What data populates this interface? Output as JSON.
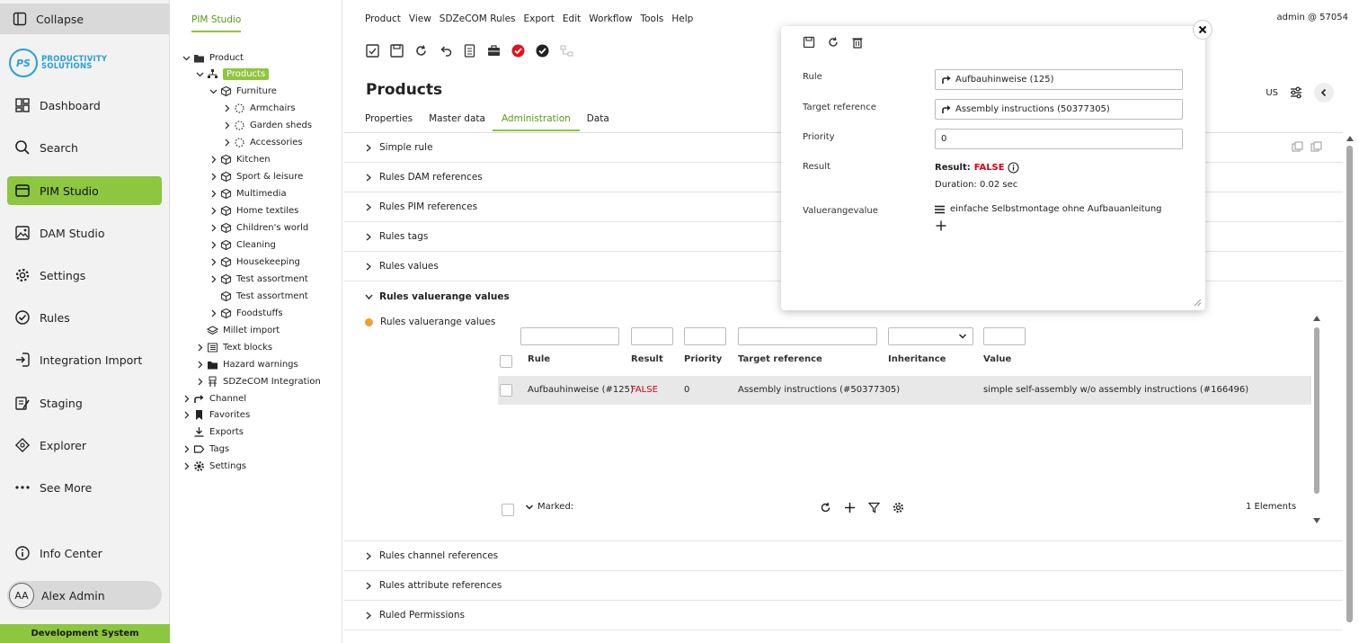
{
  "nav": {
    "collapse": "Collapse",
    "logo_mark": "PS",
    "logo_line1": "PRODUCTIVITY",
    "logo_line2": "SOLUTIONS",
    "items": [
      "Dashboard",
      "Search",
      "PIM Studio",
      "DAM Studio",
      "Settings",
      "Rules",
      "Integration Import",
      "Staging",
      "Explorer",
      "See More"
    ],
    "info_center": "Info Center",
    "user_initials": "AA",
    "user_name": "Alex Admin",
    "env": "Development System",
    "accent": "#8dc63f"
  },
  "tree": {
    "tab": "PIM Studio",
    "nodes": [
      "Product",
      "Products",
      "Furniture",
      "Armchairs",
      "Garden sheds",
      "Accessories",
      "Kitchen",
      "Sport & leisure",
      "Multimedia",
      "Home textiles",
      "Children's world",
      "Cleaning",
      "Housekeeping",
      "Test assortment",
      "Test assortment",
      "Foodstuffs",
      "Millet import",
      "Text blocks",
      "Hazard warnings",
      "SDZeCOM Integration",
      "Channel",
      "Favorites",
      "Exports",
      "Tags",
      "Settings"
    ]
  },
  "menu": [
    "Product",
    "View",
    "SDZeCOM Rules",
    "Export",
    "Edit",
    "Workflow",
    "Tools",
    "Help"
  ],
  "user_info": "admin @ 57054",
  "page_title": "Products",
  "locale": "US",
  "tabs": [
    "Properties",
    "Master data",
    "Administration",
    "Data"
  ],
  "sections_top": [
    "Simple rule",
    "Rules DAM references",
    "Rules PIM references",
    "Rules tags",
    "Rules values",
    "Rules valuerange values"
  ],
  "sub_title": "Rules valuerange values",
  "table": {
    "columns": [
      "Rule",
      "Result",
      "Priority",
      "Target reference",
      "Inheritance",
      "Value"
    ],
    "row": {
      "rule": "Aufbauhinweise (#125)",
      "result": "FALSE",
      "priority": "0",
      "target": "Assembly instructions (#50377305)",
      "inheritance": "",
      "value": "simple self-assembly w/o assembly instructions (#166496)"
    },
    "marked": "Marked:",
    "count": "1 Elements"
  },
  "sections_bottom": [
    "Rules channel references",
    "Rules attribute references",
    "Ruled Permissions"
  ],
  "popup": {
    "labels": [
      "Rule",
      "Target reference",
      "Priority",
      "Result",
      "Valuerangevalue"
    ],
    "rule_value": "Aufbauhinweise (125)",
    "target_value": "Assembly instructions (50377305)",
    "priority_value": "0",
    "result_prefix": "Result:",
    "result_value": "FALSE",
    "duration": "Duration: 0.02 sec",
    "valuerange": "einfache Selbstmontage ohne Aufbauanleitung"
  }
}
